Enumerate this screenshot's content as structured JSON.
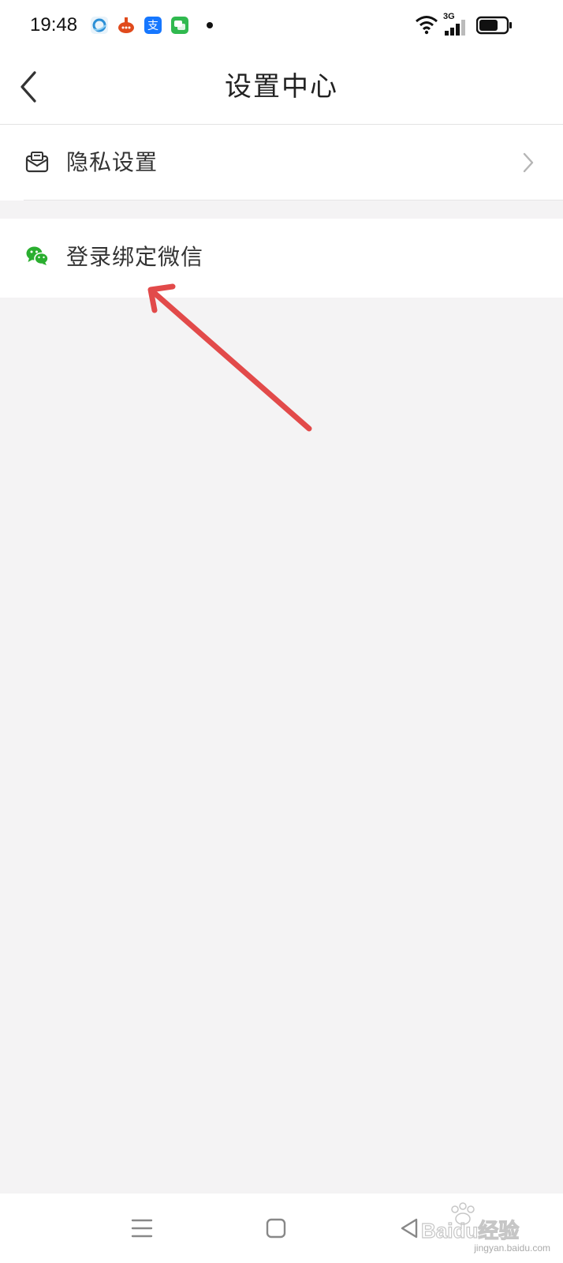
{
  "status_bar": {
    "time": "19:48",
    "app_icons": [
      "browser-icon",
      "store-icon",
      "alipay-icon",
      "messages-icon"
    ],
    "network_label": "3G",
    "battery_level": 0.7
  },
  "header": {
    "title": "设置中心",
    "back_icon": "chevron-left-icon"
  },
  "settings": {
    "items": [
      {
        "label": "隐私设置",
        "icon": "privacy-envelope-icon",
        "has_chevron": true
      },
      {
        "label": "登录绑定微信",
        "icon": "wechat-icon",
        "has_chevron": false
      }
    ]
  },
  "annotation": {
    "color": "#e24a4a"
  },
  "bottom_nav": {
    "buttons": [
      "menu-icon",
      "home-icon",
      "back-triangle-icon"
    ]
  },
  "watermark": {
    "logo_text": "Baidu经验",
    "url": "jingyan.baidu.com"
  },
  "colors": {
    "background": "#f4f3f4",
    "surface": "#ffffff",
    "wechat_green": "#2aae2f",
    "text": "#222222"
  }
}
